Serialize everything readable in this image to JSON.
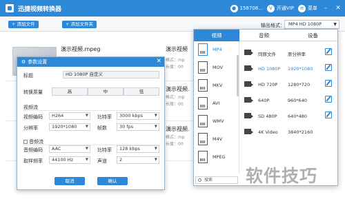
{
  "app": {
    "title": "迅捷视频转换器",
    "user": "158708...",
    "vip": "开通VIP",
    "menu": "菜单"
  },
  "toolbar": {
    "add_file": "+ 添加文件",
    "add_folder": "+ 添加文件夹",
    "output_label": "输出格式：",
    "output_value": "MP4  HD 1080P"
  },
  "files": [
    {
      "name": "演示视频.mpeg",
      "meta1": "格式：mp",
      "meta2": "长度：00"
    },
    {
      "name": "演示视频",
      "meta1": "格式：mp",
      "meta2": "长度：00"
    },
    {
      "name": "演示视频",
      "meta1": "格式：mp",
      "meta2": "长度：00"
    }
  ],
  "right_names": [
    "演示视频",
    "演示视频.",
    "演示视频."
  ],
  "right_meta": [
    [
      "格式：mp",
      "长度：00"
    ],
    [
      "格式：mp",
      "长度：00"
    ],
    [
      "格式：mp",
      "长度：00"
    ]
  ],
  "dialog": {
    "title": "参数设置",
    "title_label": "标题",
    "title_value": "HD 1080P 自定义",
    "quality_label": "转换质量",
    "quality_options": [
      "高",
      "中",
      "低"
    ],
    "video_section": "视频流",
    "video_codec_label": "视频编码",
    "video_codec": "H264",
    "bitrate_label": "比特率",
    "video_bitrate": "3000 kbps",
    "resolution_label": "分辨率",
    "resolution": "1920*1080",
    "fps_label": "帧数",
    "fps": "30 fps",
    "audio_section": "音频流",
    "audio_codec_label": "音频编码",
    "audio_codec": "AAC",
    "audio_bitrate_label": "比特率",
    "audio_bitrate": "128 kbps",
    "sample_label": "取样频率",
    "sample": "44100 Hz",
    "channel_label": "声道",
    "channel": "2",
    "cancel": "取消",
    "ok": "确认"
  },
  "panel": {
    "tabs": [
      "视频",
      "音频",
      "设备"
    ],
    "formats": [
      "MP4",
      "MOV",
      "MKV",
      "AVI",
      "WMV",
      "M4V",
      "MPEG"
    ],
    "search_placeholder": "搜索",
    "resolutions": [
      {
        "name": "同原文件",
        "dim": "原分辨率"
      },
      {
        "name": "HD 1080P",
        "dim": "1920*1080"
      },
      {
        "name": "HD 720P",
        "dim": "1280*720"
      },
      {
        "name": "640P",
        "dim": "960*640"
      },
      {
        "name": "SD 480P",
        "dim": "640*480"
      },
      {
        "name": "4K Video",
        "dim": "3840*2160"
      }
    ]
  },
  "watermark": "软件技巧",
  "colors": {
    "accent": "#2d88d8"
  }
}
